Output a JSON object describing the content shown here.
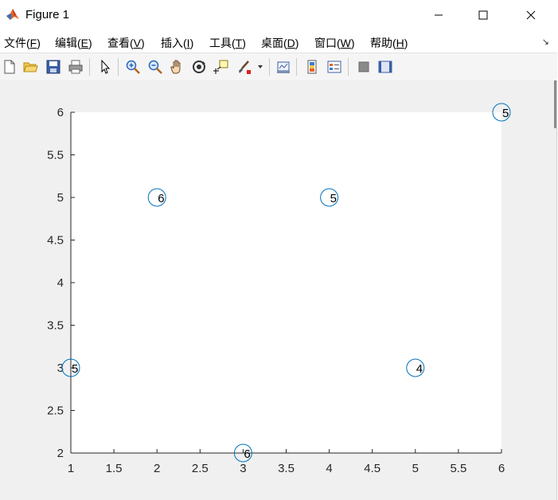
{
  "window": {
    "title": "Figure 1",
    "controls": [
      "minimize",
      "maximize",
      "close"
    ]
  },
  "menu": {
    "items": [
      {
        "label": "文件(",
        "key": "F",
        "close": ")"
      },
      {
        "label": "编辑(",
        "key": "E",
        "close": ")"
      },
      {
        "label": "查看(",
        "key": "V",
        "close": ")"
      },
      {
        "label": "插入(",
        "key": "I",
        "close": ")"
      },
      {
        "label": "工具(",
        "key": "T",
        "close": ")"
      },
      {
        "label": "桌面(",
        "key": "D",
        "close": ")"
      },
      {
        "label": "窗口(",
        "key": "W",
        "close": ")"
      },
      {
        "label": "帮助(",
        "key": "H",
        "close": ")"
      }
    ]
  },
  "toolbar": {
    "icons": [
      "new-figure-icon",
      "open-file-icon",
      "save-icon",
      "print-icon",
      "select-pointer-icon",
      "zoom-in-icon",
      "zoom-out-icon",
      "pan-hand-icon",
      "rotate-3d-icon",
      "data-cursor-icon",
      "brush-icon",
      "link-plot-icon",
      "colorbar-icon",
      "legend-icon",
      "hide-plot-tools-icon",
      "show-plot-tools-icon"
    ]
  },
  "colors": {
    "marker": "#0072bd",
    "axes_bg": "#ffffff",
    "figure_bg": "#f0f0f0"
  },
  "chart_data": {
    "type": "scatter",
    "marker": "circle",
    "x": [
      1,
      2,
      3,
      4,
      5,
      6
    ],
    "y": [
      3,
      5,
      2,
      5,
      3,
      6
    ],
    "point_labels": [
      "5",
      "6",
      "6",
      "5",
      "4",
      "5"
    ],
    "xlim": [
      1,
      6
    ],
    "ylim": [
      2,
      6
    ],
    "xticks": [
      "1",
      "1.5",
      "2",
      "2.5",
      "3",
      "3.5",
      "4",
      "4.5",
      "5",
      "5.5",
      "6"
    ],
    "yticks": [
      "2",
      "2.5",
      "3",
      "3.5",
      "4",
      "4.5",
      "5",
      "5.5",
      "6"
    ],
    "grid": false,
    "title": "",
    "xlabel": "",
    "ylabel": ""
  }
}
